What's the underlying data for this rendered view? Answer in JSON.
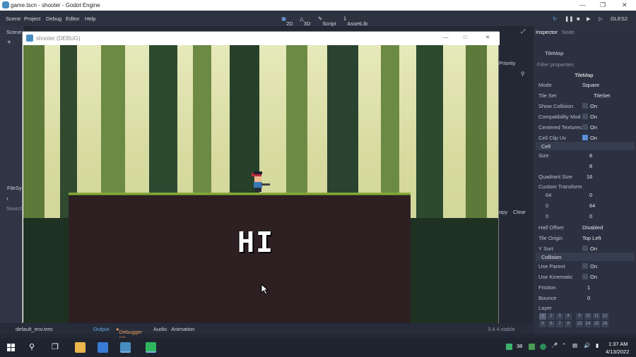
{
  "titlebar": {
    "title": "game.tscn - shooter - Godot Engine"
  },
  "menu": {
    "items": [
      "Scene",
      "Project",
      "Debug",
      "Editor",
      "Help"
    ]
  },
  "workspaces": {
    "d2": "2D",
    "d3": "3D",
    "script": "Script",
    "assetlib": "AssetLib"
  },
  "renderer": "GLES2",
  "left_dock": {
    "scene_tab": "Scene",
    "filesystem_tab": "FileSys",
    "search_label": "Search",
    "default_env": "default_env.tres"
  },
  "game_window": {
    "title": "shooter (DEBUG)",
    "hi_text": "HI"
  },
  "right_fragments": {
    "priority": "Priority",
    "copy": "opy",
    "clear": "Clear"
  },
  "inspector": {
    "tabs": [
      "Inspector",
      "Node"
    ],
    "node_name": "TileMap",
    "filter_placeholder": "Filter properties",
    "header": "TileMap",
    "props": [
      {
        "k": "Mode",
        "v": "Square"
      },
      {
        "k": "Tile Set",
        "v": "TileSet"
      },
      {
        "k": "Show Collision",
        "v": "On"
      },
      {
        "k": "Compatibility Mod",
        "v": "On"
      },
      {
        "k": "Centered Textures",
        "v": "On"
      },
      {
        "k": "Cell Clip Uv",
        "v": "On"
      }
    ],
    "cell_section": "Cell",
    "cell_size": {
      "label": "Size",
      "x": "8",
      "y": "8"
    },
    "quadrant": {
      "label": "Quadrant Size",
      "v": "16"
    },
    "custom_transform": {
      "label": "Custom Transform",
      "values": [
        "64",
        "0",
        "0",
        "64",
        "0",
        "0"
      ]
    },
    "half_offset": {
      "label": "Half Offset",
      "v": "Disabled"
    },
    "tile_origin": {
      "label": "Tile Origin",
      "v": "Top Left"
    },
    "y_sort": {
      "label": "Y Sort",
      "v": "On"
    },
    "collision_section": "Collision",
    "use_parent": {
      "label": "Use Parent",
      "v": "On"
    },
    "use_kinematic": {
      "label": "Use Kinematic",
      "v": "On"
    },
    "friction": {
      "label": "Friction",
      "v": "1"
    },
    "bounce": {
      "label": "Bounce",
      "v": "0"
    },
    "layer": {
      "label": "Layer",
      "values": [
        "1",
        "2",
        "3",
        "4",
        "9",
        "10",
        "11",
        "12",
        "5",
        "6",
        "7",
        "8",
        "13",
        "14",
        "15",
        "16"
      ]
    }
  },
  "bottom": {
    "tabs": [
      "Output",
      "Debugger (3)",
      "Audio",
      "Animation"
    ],
    "version": "3.4.4.stable"
  },
  "taskbar": {
    "time": "1:37 AM",
    "date": "4/13/2022",
    "badge": "38"
  },
  "colors": {
    "accent": "#478cbf",
    "editor_bg": "#232834",
    "grass": "#86a83a",
    "soil": "#2e1f22"
  }
}
